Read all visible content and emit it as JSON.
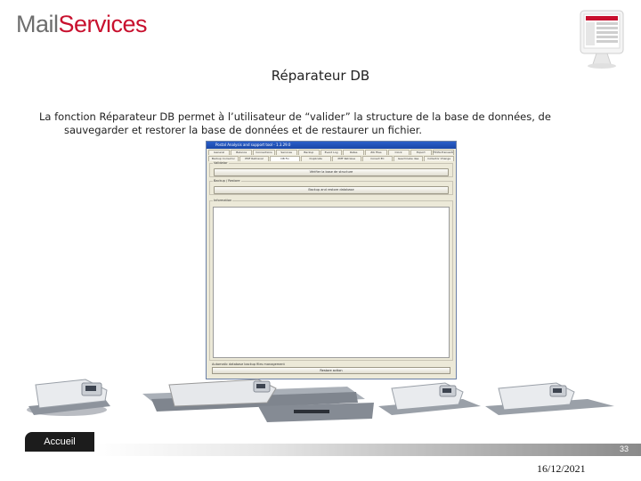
{
  "brand": {
    "mail": "Mail",
    "services": "Services"
  },
  "slide": {
    "title": "Réparateur DB",
    "description_line1": "La fonction Réparateur DB permet à l’utilisateur de “valider” la structure de la base de données, de",
    "description_line2": "sauvegarder et restorer la base de données et de restaurer un fichier."
  },
  "app": {
    "window_title": "Postal Analysis and support tool - 1.3.29.0",
    "tabs_row1": [
      "General",
      "Balance",
      "Connections",
      "Services",
      "Backup",
      "Event Log",
      "Rates",
      "Zib Files",
      "Clock",
      "Export",
      "FP-PA-Transaction"
    ],
    "tabs_row2": [
      "Backup Corrector",
      "PMF Retrieval",
      "DB Fix",
      "Duplicate",
      "PMF Retrieve",
      "Conect EC",
      "Geschriebe daa",
      "Collector Change"
    ],
    "validate_label": "Validator",
    "validate_button": "Vérifier la base de structure",
    "backup_label": "Backup / Restore",
    "backup_button": "Backup and restore database",
    "info_label": "Information",
    "footer_label": "Automatic database backup files management",
    "footer_button": "Restore action"
  },
  "footer": {
    "home_button": "Accueil",
    "page_number": "33",
    "date": "16/12/2021"
  }
}
